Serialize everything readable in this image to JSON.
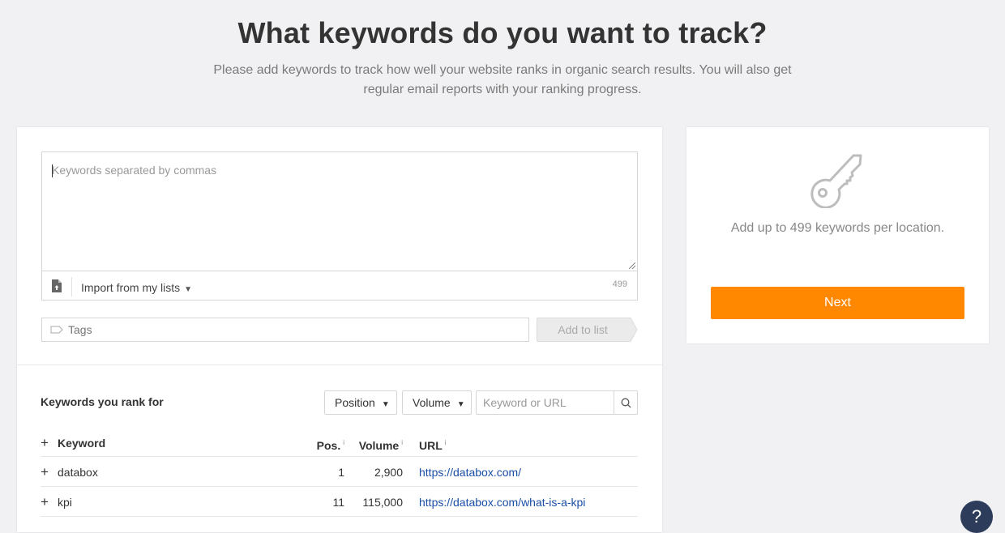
{
  "header": {
    "title": "What keywords do you want to track?",
    "subtitle": "Please add keywords to track how well your website ranks in organic search results. You will also get regular email reports with your ranking progress."
  },
  "keywords_input": {
    "placeholder": "Keywords separated by commas",
    "value": "",
    "upload_icon": "file-upload-icon",
    "import_label": "Import from my lists",
    "remaining_count": "499"
  },
  "tags": {
    "placeholder": "Tags",
    "icon": "tag-icon",
    "add_to_list_label": "Add to list"
  },
  "ranked_keywords": {
    "title": "Keywords you rank for",
    "filters": {
      "position_label": "Position",
      "volume_label": "Volume",
      "search_placeholder": "Keyword or URL"
    },
    "columns": {
      "keyword": "Keyword",
      "pos": "Pos.",
      "volume": "Volume",
      "url": "URL",
      "info_marker": "i"
    },
    "rows": [
      {
        "keyword": "databox",
        "pos": "1",
        "volume": "2,900",
        "url": "https://databox.com/"
      },
      {
        "keyword": "kpi",
        "pos": "11",
        "volume": "115,000",
        "url": "https://databox.com/what-is-a-kpi"
      }
    ]
  },
  "sidebar": {
    "icon": "key-icon",
    "limit_text": "Add up to 499 keywords per location.",
    "next_label": "Next"
  },
  "help": {
    "label": "?"
  },
  "colors": {
    "accent": "#ff8800",
    "link": "#1a4ea6",
    "help_bg": "#2d3c5a",
    "background": "#f1f1f3"
  }
}
